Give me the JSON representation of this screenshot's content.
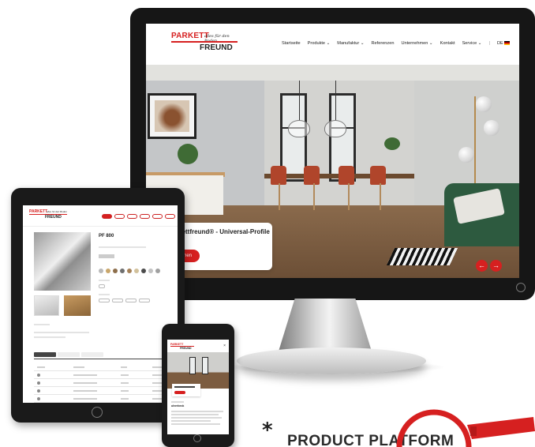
{
  "site": {
    "logo_top": "PARKETT",
    "logo_tagline": "alles für den Boden",
    "logo_bottom": "FREUND",
    "nav": [
      {
        "label": "Startseite"
      },
      {
        "label": "Produkte",
        "chevron": "⌄"
      },
      {
        "label": "Manufaktur",
        "chevron": "⌄"
      },
      {
        "label": "Referenzen"
      },
      {
        "label": "Unternehmen",
        "chevron": "⌄"
      },
      {
        "label": "Kontakt"
      },
      {
        "label": "Service",
        "chevron": "⌄"
      }
    ],
    "language": "DE",
    "hero_title": "rkettfreund® - Universal-Profile",
    "hero_button": "ansehen",
    "prev_arrow": "←",
    "next_arrow": "→"
  },
  "tablet": {
    "product_title": "PF 800"
  },
  "phone": {
    "section_title": "ulverbeck"
  },
  "branding": {
    "asterisk": "*",
    "label": "PRODUCT PLATFORM"
  },
  "colors": {
    "brand_red": "#d62020",
    "device_dark": "#161616"
  }
}
